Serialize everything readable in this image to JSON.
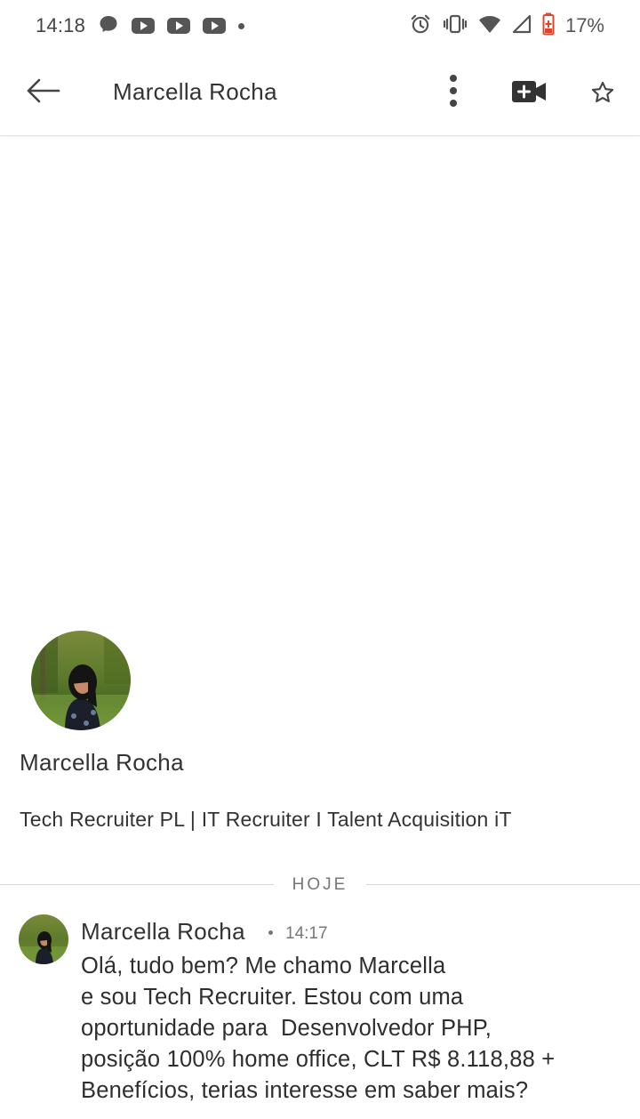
{
  "status_bar": {
    "time": "14:18",
    "battery": "17%",
    "left_icons": [
      "messenger-icon",
      "youtube-icon",
      "youtube-icon",
      "youtube-icon",
      "more-notifications-dot"
    ],
    "right_icons": [
      "alarm-icon",
      "vibrate-icon",
      "wifi-icon",
      "cell-signal-icon",
      "battery-icon"
    ]
  },
  "app_bar": {
    "title": "Marcella Rocha",
    "icons": [
      "back-arrow-icon",
      "more-vert-icon",
      "video-call-icon",
      "star-icon"
    ]
  },
  "profile": {
    "name": "Marcella Rocha",
    "headline": "Tech Recruiter PL | IT Recruiter I Talent Acquisition iT"
  },
  "divider": {
    "label": "HOJE"
  },
  "message": {
    "sender": "Marcella Rocha",
    "time": "14:17",
    "lines": [
      "Olá, tudo bem? Me chamo Marcella",
      "e sou Tech Recruiter. Estou com uma",
      "oportunidade para  Desenvolvedor PHP,",
      "posição 100% home office, CLT R$ 8.118,88 +",
      "Benefícios, terias interesse em saber mais?"
    ]
  },
  "colors": {
    "background": "#ffffff",
    "text": "#333333",
    "muted": "#777777",
    "battery_low": "#e0452b"
  }
}
